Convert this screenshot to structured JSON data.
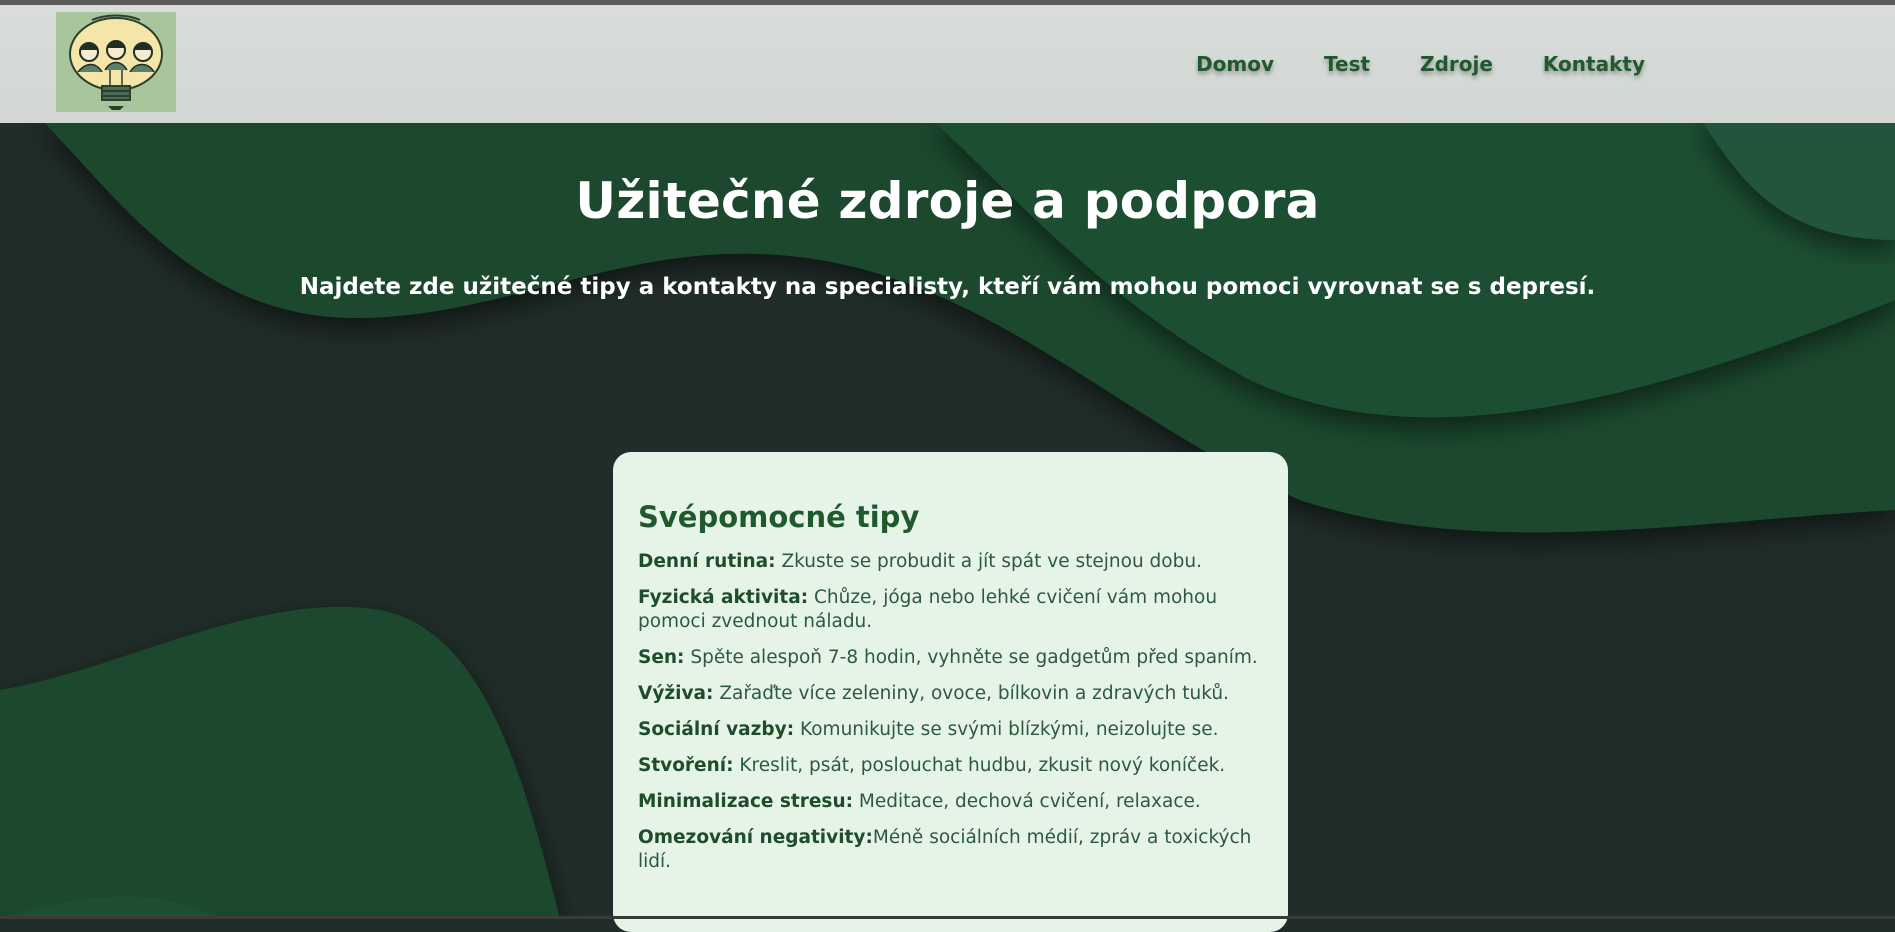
{
  "nav": {
    "logo_alt": "logo",
    "items": [
      "Domov",
      "Test",
      "Zdroje",
      "Kontakty"
    ]
  },
  "hero": {
    "title": "Užitečné zdroje a podpora",
    "subtitle": "Najdete zde užitečné tipy a kontakty na specialisty, kteří vám mohou pomoci vyrovnat se s depresí."
  },
  "card": {
    "title": "Svépomocné tipy",
    "tips": [
      {
        "label": "Denní rutina:",
        "text": " Zkuste se probudit a jít spát ve stejnou dobu."
      },
      {
        "label": "Fyzická aktivita:",
        "text": " Chůze, jóga nebo lehké cvičení vám mohou pomoci zvednout náladu."
      },
      {
        "label": "Sen:",
        "text": " Spěte alespoň 7-8 hodin, vyhněte se gadgetům před spaním."
      },
      {
        "label": "Výživa:",
        "text": " Zařaďte více zeleniny, ovoce, bílkovin a zdravých tuků."
      },
      {
        "label": "Sociální vazby:",
        "text": " Komunikujte se svými blízkými, neizolujte se."
      },
      {
        "label": "Stvoření:",
        "text": " Kreslit, psát, poslouchat hudbu, zkusit nový koníček."
      },
      {
        "label": "Minimalizace stresu:",
        "text": " Meditace, dechová cvičení, relaxace."
      },
      {
        "label": "Omezování negativity:",
        "text": "Méně sociálních médií, zpráv a toxických lidí."
      }
    ]
  },
  "colors": {
    "accent": "#1f5a2d",
    "card_bg": "#e6f4e8",
    "header_bg": "#d4d8d6",
    "wave_dark": "#202d28",
    "wave_green": "#1e4d30"
  }
}
